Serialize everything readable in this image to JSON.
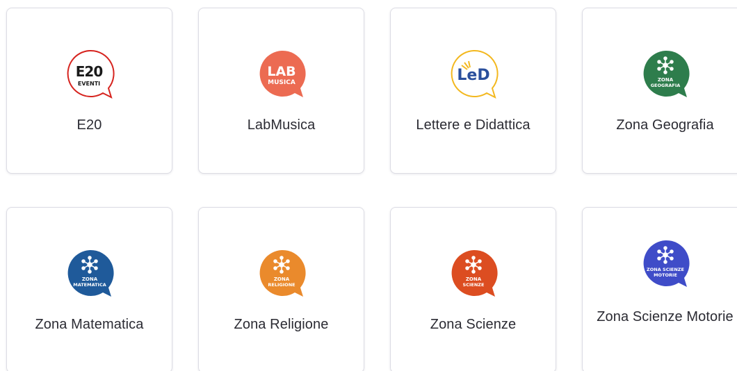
{
  "cards": [
    {
      "title": "E20",
      "logo": {
        "icon": "e20-eventi-logo-icon",
        "line1": "E20",
        "line2": "EVENTI",
        "color": "#d6241f"
      }
    },
    {
      "title": "LabMusica",
      "logo": {
        "icon": "labmusica-logo-icon",
        "line1": "LAB",
        "line2": "MUSICA",
        "color": "#ec6b52"
      }
    },
    {
      "title": "Lettere e Didattica",
      "logo": {
        "icon": "led-logo-icon",
        "line1": "LeD",
        "color": "#f3b81f"
      }
    },
    {
      "title": "Zona Geografia",
      "logo": {
        "icon": "zona-geografia-logo-icon",
        "line1": "ZONA",
        "line2": "GEOGRAFIA",
        "color": "#2e7d4c"
      }
    },
    {
      "title": "Zona Matematica",
      "logo": {
        "icon": "zona-matematica-logo-icon",
        "line1": "ZONA",
        "line2": "MATEMATICA",
        "color": "#1f5a9a"
      }
    },
    {
      "title": "Zona Religione",
      "logo": {
        "icon": "zona-religione-logo-icon",
        "line1": "ZONA",
        "line2": "RELIGIONE",
        "color": "#ea8a2c"
      }
    },
    {
      "title": "Zona Scienze",
      "logo": {
        "icon": "zona-scienze-logo-icon",
        "line1": "ZONA",
        "line2": "SCIENZE",
        "color": "#dc4d21"
      }
    },
    {
      "title": "Zona Scienze Motorie",
      "logo": {
        "icon": "zona-scienze-motorie-logo-icon",
        "line1": "ZONA SCIENZE",
        "line2": "MOTORIE",
        "color": "#3f4cc8"
      }
    }
  ]
}
